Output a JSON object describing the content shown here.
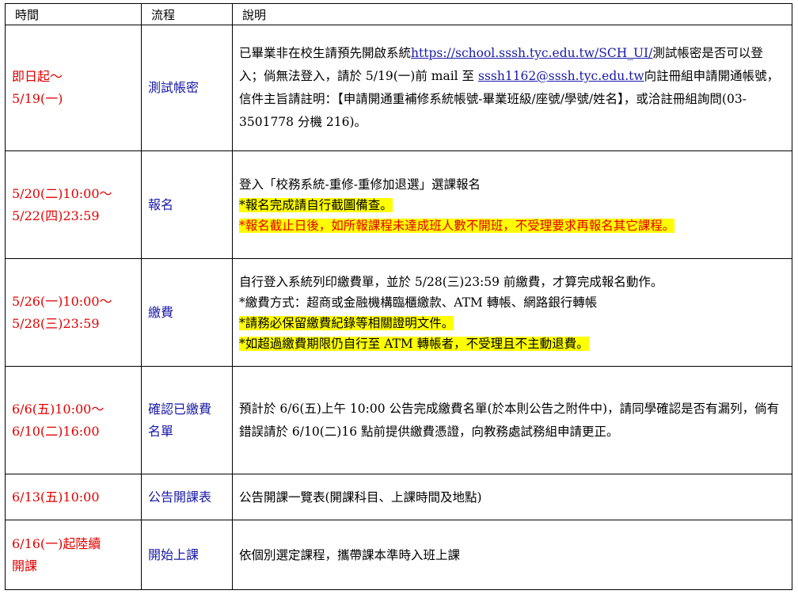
{
  "header": {
    "time": "時間",
    "process": "流程",
    "description": "說明"
  },
  "rows": [
    {
      "time": [
        "即日起～",
        "5/19(一)"
      ],
      "step": [
        "測試帳密"
      ],
      "desc": {
        "p1": "已畢業非在校生請預先開啟系統",
        "url": "https://school.sssh.tyc.edu.tw/SCH_UI/",
        "p2": "測試帳密是否可以登入；倘無法登入，請於 5/19(一)前 mail 至",
        "email": "sssh1162@sssh.tyc.edu.tw",
        "p3": "向註冊組申請開通帳號，信件主旨請註明：【申請開通重補修系統帳號-畢業班級/座號/學號/姓名】，或洽註冊組詢問(03-3501778 分機 216)。"
      }
    },
    {
      "time": [
        "5/20(二)10:00～",
        "5/22(四)23:59"
      ],
      "step": [
        "報名"
      ],
      "desc": {
        "l1": "登入「校務系統-重修-重修加退選」選課報名",
        "l2": "*報名完成請自行截圖備查。",
        "l3": "*報名截止日後，如所報課程未達成班人數不開班，不受理要求再報名其它課程。"
      }
    },
    {
      "time": [
        "5/26(一)10:00～",
        "5/28(三)23:59"
      ],
      "step": [
        "繳費"
      ],
      "desc": {
        "l1": "自行登入系統列印繳費單，並於 5/28(三)23:59 前繳費，才算完成報名動作。",
        "l2": "*繳費方式：超商或金融機構臨櫃繳款、ATM 轉帳、網路銀行轉帳",
        "l3": "*請務必保留繳費紀錄等相關證明文件。",
        "l4": "*如超過繳費期限仍自行至 ATM 轉帳者，不受理且不主動退費。"
      }
    },
    {
      "time": [
        "6/6(五)10:00～",
        "6/10(二)16:00"
      ],
      "step": [
        "確認已繳費",
        "名單"
      ],
      "desc": {
        "l1": "預計於 6/6(五)上午 10:00 公告完成繳費名單(於本則公告之附件中)，請同學確認是否有漏列，倘有錯誤請於 6/10(二)16 點前提供繳費憑證，向教務處試務組申請更正。"
      }
    },
    {
      "time": [
        "6/13(五)10:00"
      ],
      "step": [
        "公告開課表"
      ],
      "desc": {
        "l1": "公告開課一覽表(開課科目、上課時間及地點)"
      }
    },
    {
      "time": [
        "6/16(一)起陸續",
        "開課"
      ],
      "step": [
        "開始上課"
      ],
      "desc": {
        "l1": "依個別選定課程，攜帶課本準時入班上課"
      }
    }
  ],
  "colors": {
    "time_text": "#e00000",
    "step_text": "#1a1aa6",
    "link": "#1a1aa6",
    "highlight": "#ffff00",
    "warning_text": "#e00000"
  }
}
